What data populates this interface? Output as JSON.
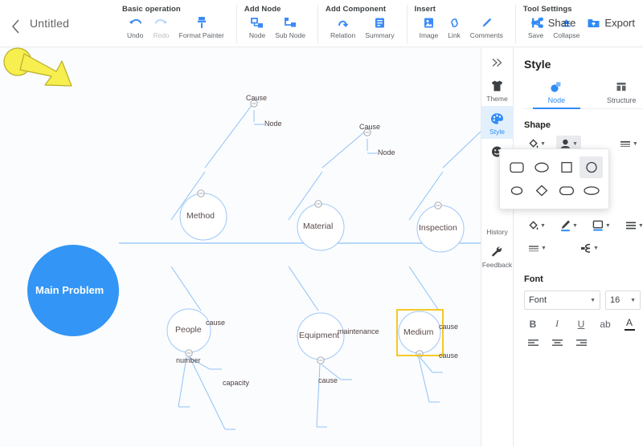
{
  "header": {
    "back_icon": "chevron-left-icon",
    "title": "Untitled",
    "groups": [
      {
        "title": "Basic operation",
        "items": [
          {
            "label": "Undo",
            "icon": "undo-arrow-icon",
            "disabled": false
          },
          {
            "label": "Redo",
            "icon": "redo-arrow-icon",
            "disabled": true
          },
          {
            "label": "Format Painter",
            "icon": "paintbrush-icon",
            "disabled": false
          }
        ]
      },
      {
        "title": "Add Node",
        "items": [
          {
            "label": "Node",
            "icon": "add-node-icon",
            "disabled": false
          },
          {
            "label": "Sub Node",
            "icon": "add-subnode-icon",
            "disabled": false
          }
        ]
      },
      {
        "title": "Add Component",
        "items": [
          {
            "label": "Relation",
            "icon": "relation-arrow-icon",
            "disabled": false
          },
          {
            "label": "Summary",
            "icon": "summary-bracket-icon",
            "disabled": false
          }
        ]
      },
      {
        "title": "Insert",
        "items": [
          {
            "label": "Image",
            "icon": "image-icon",
            "disabled": false
          },
          {
            "label": "Link",
            "icon": "link-chain-icon",
            "disabled": false
          },
          {
            "label": "Comments",
            "icon": "pencil-comment-icon",
            "disabled": false
          }
        ]
      },
      {
        "title": "Tool Settings",
        "items": [
          {
            "label": "Save",
            "icon": "save-disk-icon",
            "disabled": false
          },
          {
            "label": "Collapse",
            "icon": "collapse-triangle-icon",
            "disabled": false
          }
        ]
      }
    ],
    "actions": [
      {
        "label": "Share",
        "icon": "share-nodes-icon"
      },
      {
        "label": "Export",
        "icon": "export-folder-icon"
      }
    ]
  },
  "canvas": {
    "center": {
      "label": "Main Problem",
      "fill": "#3395f5"
    },
    "branch_color": "#8fc2f5",
    "selection_color": "#f5c211",
    "branches": [
      {
        "label": "Method",
        "children": []
      },
      {
        "label": "Material",
        "children": []
      },
      {
        "label": "Inspection",
        "children": []
      },
      {
        "label": "People",
        "children": [
          "cause",
          "number",
          "capacity"
        ]
      },
      {
        "label": "Equipment",
        "children": [
          "maintenance",
          "cause"
        ]
      },
      {
        "label": "Medium",
        "children": [
          "cause",
          "cause"
        ],
        "selected": true
      }
    ],
    "top_leaves": [
      {
        "cause": "Cause",
        "node": "Node"
      },
      {
        "cause": "Cause",
        "node": "Node"
      }
    ],
    "annotation_icon": "yellow-pointer-arrow"
  },
  "right_panel": {
    "collapse_icon": "double-chevron-right-icon",
    "rail": [
      {
        "label": "Theme",
        "icon": "tshirt-icon",
        "active": false
      },
      {
        "label": "Style",
        "icon": "palette-icon",
        "active": true
      },
      {
        "label": "",
        "icon": "smiley-icon",
        "active": false
      },
      {
        "label": "History",
        "icon": "history-icon",
        "active": false
      },
      {
        "label": "Feedback",
        "icon": "wrench-icon",
        "active": false
      }
    ],
    "title": "Style",
    "tabs": [
      {
        "label": "Node",
        "icon": "node-shape-icon",
        "active": true
      },
      {
        "label": "Structure",
        "icon": "structure-grid-icon",
        "active": false
      }
    ],
    "shape_section": {
      "title": "Shape",
      "fill_icon": "paint-bucket-icon",
      "shape_icon": "shape-picker-icon",
      "line_icon": "line-style-icon",
      "shapes": [
        {
          "name": "rounded-rectangle",
          "selected": false
        },
        {
          "name": "ellipse-wide",
          "selected": false
        },
        {
          "name": "square",
          "selected": false
        },
        {
          "name": "circle",
          "selected": true
        },
        {
          "name": "ellipse-small",
          "selected": false
        },
        {
          "name": "diamond",
          "selected": false
        },
        {
          "name": "stadium",
          "selected": false
        },
        {
          "name": "oval-wide",
          "selected": false
        }
      ]
    },
    "format_row_1": [
      {
        "name": "fill-color-button",
        "icon": "paint-bucket-icon",
        "underline": ""
      },
      {
        "name": "pen-color-button",
        "icon": "pen-icon",
        "underline": "#2f8bf5"
      },
      {
        "name": "border-style-button",
        "icon": "border-box-icon",
        "underline": "#2f8bf5"
      },
      {
        "name": "line-weight-button",
        "icon": "lines-icon",
        "underline": ""
      }
    ],
    "format_row_2": [
      {
        "name": "dash-style-button",
        "icon": "dashed-lines-icon",
        "underline": ""
      },
      {
        "name": "branch-style-button",
        "icon": "branch-icon",
        "underline": ""
      }
    ],
    "font_section": {
      "title": "Font",
      "family_value": "Font",
      "size_value": "16",
      "styles": [
        {
          "label": "B",
          "name": "bold-button"
        },
        {
          "label": "I",
          "name": "italic-button"
        },
        {
          "label": "U",
          "name": "underline-button"
        },
        {
          "label": "ab",
          "name": "strikethrough-button"
        },
        {
          "label": "A",
          "name": "text-color-button"
        }
      ],
      "aligns": [
        {
          "name": "align-left-button"
        },
        {
          "name": "align-center-button"
        },
        {
          "name": "align-right-button"
        }
      ]
    }
  }
}
